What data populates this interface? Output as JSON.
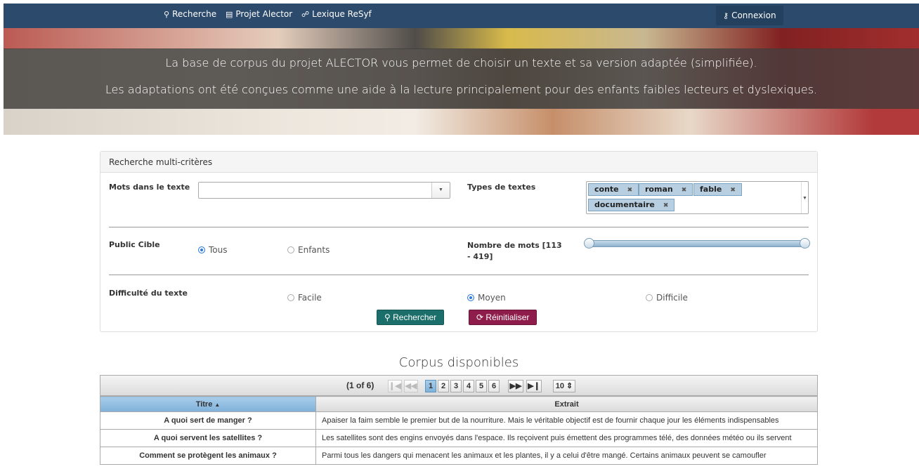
{
  "nav": {
    "search": "Recherche",
    "project": "Projet Alector",
    "lexicon": "Lexique ReSyf",
    "login": "Connexion"
  },
  "banner": {
    "line1": "La base de corpus du projet ALECTOR vous permet de choisir un texte et sa version adaptée (simplifiée).",
    "line2": "Les adaptations ont été conçues comme une aide à la lecture principalement pour des enfants faibles lecteurs et dyslexiques."
  },
  "search_panel": {
    "title": "Recherche multi-critères",
    "words_label": "Mots dans le texte",
    "words_value": "",
    "types_label": "Types de textes",
    "types_selected": [
      "conte",
      "roman",
      "fable",
      "documentaire"
    ],
    "audience_label": "Public Cible",
    "audience_options": [
      "Tous",
      "Enfants"
    ],
    "audience_selected": "Tous",
    "wordcount_label": "Nombre de mots [113 - 419]",
    "wordcount_range": [
      113,
      419
    ],
    "difficulty_label": "Difficulté du texte",
    "difficulty_options": [
      "Facile",
      "Moyen",
      "Difficile"
    ],
    "difficulty_selected": "Moyen",
    "search_button": "Rechercher",
    "reset_button": "Réinitialiser"
  },
  "corpus": {
    "title": "Corpus disponibles",
    "page_info": "(1 of 6)",
    "pages": [
      "1",
      "2",
      "3",
      "4",
      "5",
      "6"
    ],
    "current_page": "1",
    "rows_per_page": "10",
    "columns": [
      "Titre",
      "Extrait"
    ],
    "rows": [
      {
        "title": "A quoi sert de manger ?",
        "excerpt": "Apaiser la faim semble le premier but de la nourriture. Mais le véritable objectif est de fournir chaque jour les éléments indispensables"
      },
      {
        "title": "A quoi servent les satellites ?",
        "excerpt": "Les satellites sont des engins envoyés dans l'espace. Ils reçoivent puis émettent des programmes télé, des données météo ou ils servent"
      },
      {
        "title": "Comment se protègent les animaux ?",
        "excerpt": "Parmi tous les dangers qui menacent les animaux et les plantes, il y a celui d'être mangé. Certains animaux peuvent se camoufler"
      }
    ]
  },
  "colors": {
    "nav_bg": "#2c4a6b",
    "search_button": "#1b6e6a",
    "reset_button": "#8e1d4b",
    "selected_radio": "#2e7ad9"
  }
}
